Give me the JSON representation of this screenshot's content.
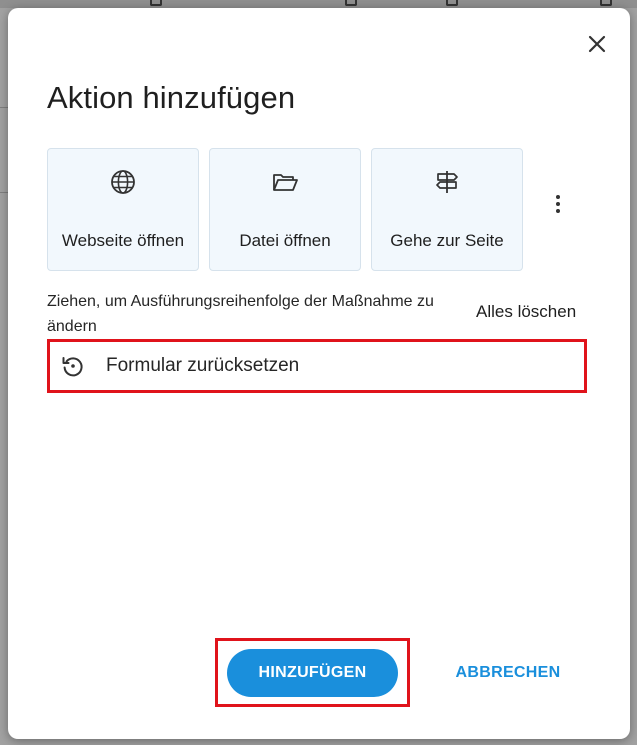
{
  "dialog": {
    "title": "Aktion hinzufügen",
    "close_icon": "close-icon",
    "tiles": [
      {
        "label": "Webseite öffnen",
        "icon": "globe-icon"
      },
      {
        "label": "Datei öffnen",
        "icon": "folder-open-icon"
      },
      {
        "label": "Gehe zur Seite",
        "icon": "signpost-icon"
      }
    ],
    "more_icon": "more-vert-icon",
    "hint": "Ziehen, um Ausführungsreihenfolge der Maßnahme zu ändern",
    "clear_all_label": "Alles löschen",
    "actions": [
      {
        "label": "Formular zurücksetzen",
        "icon": "reset-icon"
      }
    ],
    "add_button_label": "HINZUFÜGEN",
    "cancel_button_label": "ABBRECHEN"
  },
  "colors": {
    "accent": "#1a8fdc",
    "highlight": "#e0131b",
    "tile_background": "#f2f8fd"
  }
}
